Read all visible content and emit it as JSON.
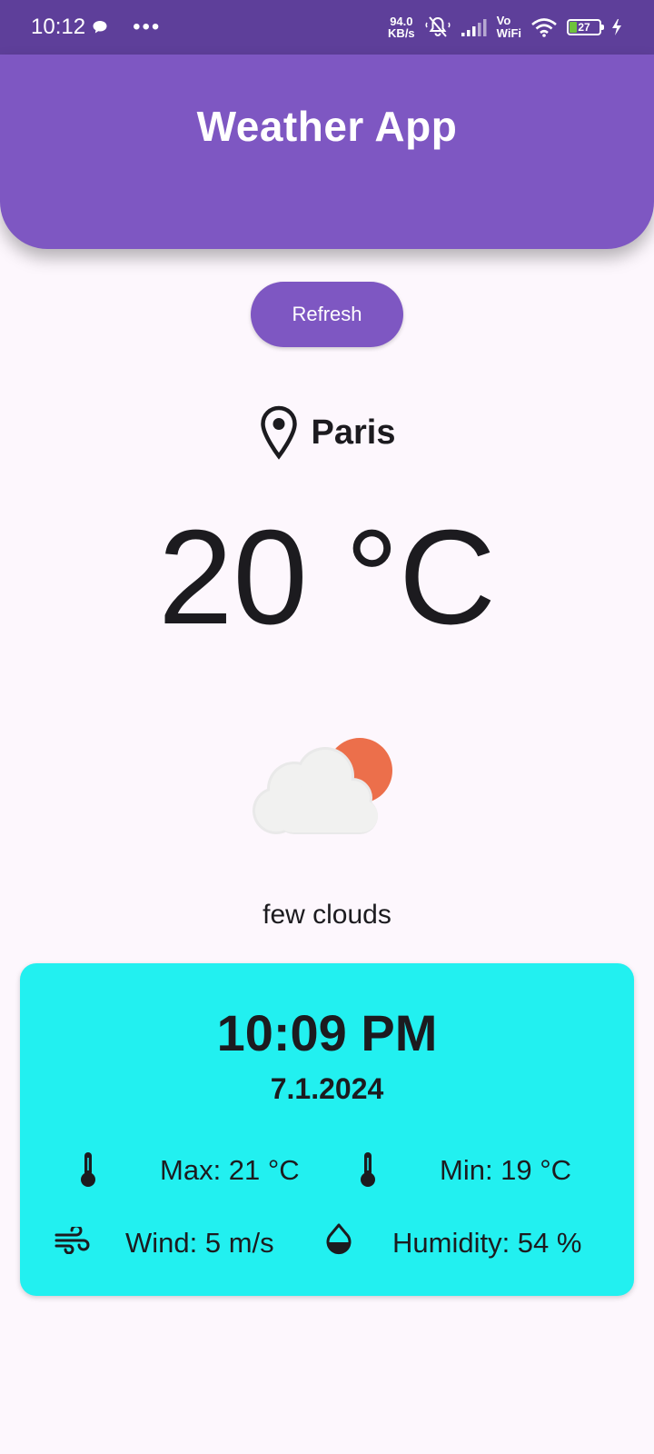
{
  "status_bar": {
    "time": "10:12",
    "network_speed_value": "94.0",
    "network_speed_unit": "KB/s",
    "vowifi_top": "Vo",
    "vowifi_bottom": "WiFi",
    "battery_level": "27",
    "icons": [
      "chat-bubble-icon",
      "more-dots-icon",
      "muted-bell-icon",
      "signal-icon",
      "wifi-icon",
      "battery-icon",
      "charging-bolt-icon"
    ]
  },
  "app_bar": {
    "title": "Weather App",
    "color": "#7e57c2"
  },
  "refresh_button": {
    "label": "Refresh"
  },
  "location": {
    "icon": "location-pin-icon",
    "city": "Paris"
  },
  "current": {
    "temperature": "20 °C",
    "icon": "few-clouds-icon",
    "description": "few clouds"
  },
  "details_card": {
    "background": "#22f0f0",
    "time": "10:09 PM",
    "date": "7.1.2024",
    "max": "Max: 21 °C",
    "min": "Min: 19 °C",
    "wind": "Wind: 5 m/s",
    "humidity": "Humidity: 54 %",
    "icons": [
      "thermometer-icon",
      "thermometer-icon",
      "wind-icon",
      "humidity-drop-icon"
    ]
  }
}
